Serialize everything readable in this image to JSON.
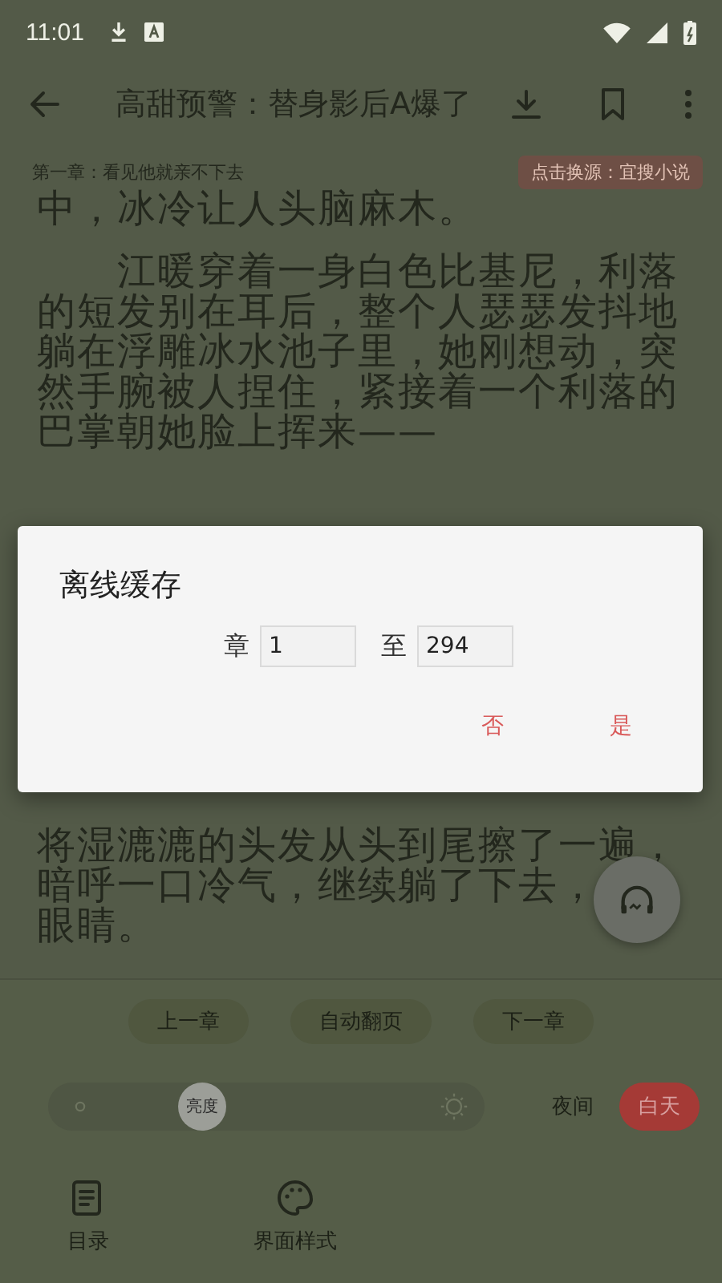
{
  "status_bar": {
    "time": "11:01"
  },
  "toolbar": {
    "title": "高甜预警：替身影后A爆了"
  },
  "chapter_bar": {
    "chapter": "第一章：看见他就亲不下去",
    "source": "点击换源：宜搜小说"
  },
  "paragraphs": [
    {
      "indent": false,
      "lines": [
        "中，冰冷让人头脑麻木。"
      ]
    },
    {
      "indent": true,
      "lines": [
        "江暖穿着一身白色比基尼，利落",
        "的短发别在耳后，整个人瑟瑟发抖地",
        "躺在浮雕冰水池子里，她刚想动，突",
        "然手腕被人捏住，紧接着一个利落的",
        "巴掌朝她脸上挥来——"
      ]
    },
    {
      "indent": false,
      "lines": [
        "将湿漉漉的头发从头到尾擦了一遍，",
        "暗呼一口冷气，继续躺了下去，",
        "眼睛。"
      ]
    }
  ],
  "dialog": {
    "title": "离线缓存",
    "from_label": "章",
    "from_value": "1",
    "to_label": "至",
    "to_value": "294",
    "buttons": [
      "否",
      "是"
    ]
  },
  "chapter_nav": [
    "上一章",
    "自动翻页",
    "下一章"
  ],
  "brightness": {
    "label": "亮度",
    "level": 0.38
  },
  "theme_toggle": [
    {
      "label": "夜间",
      "selected": false
    },
    {
      "label": "白天",
      "selected": true
    }
  ],
  "bottom_nav": [
    {
      "kind": "contents",
      "label": "目录"
    },
    {
      "kind": "style",
      "label": "界面样式"
    }
  ]
}
